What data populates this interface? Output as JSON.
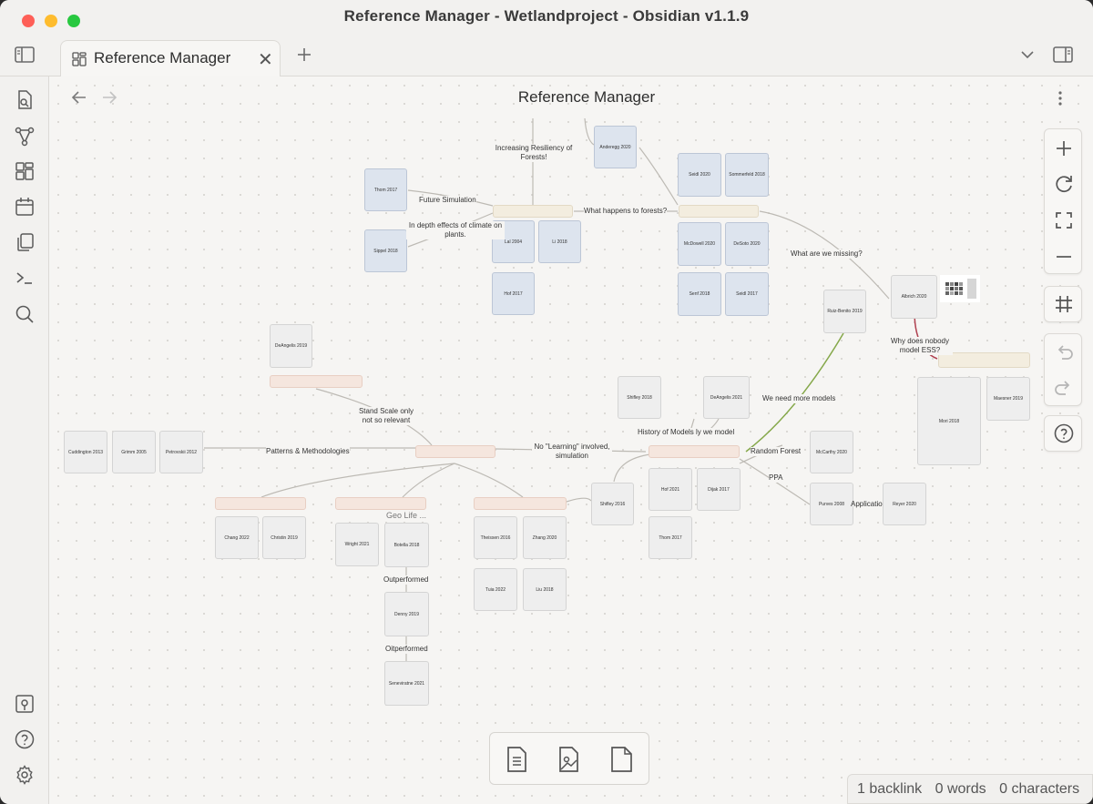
{
  "window": {
    "title": "Reference Manager - Wetlandproject - Obsidian v1.1.9"
  },
  "tab": {
    "label": "Reference Manager"
  },
  "view": {
    "title": "Reference Manager"
  },
  "status": {
    "backlinks": "1 backlink",
    "words": "0 words",
    "characters": "0 characters"
  },
  "canvas": {
    "cards": [
      "Anderegg 2020",
      "Thom 2017",
      "Seidl 2020",
      "Sommerfeld 2018",
      "Lal 2004",
      "Li 2018",
      "McDowell 2020",
      "DeSoto 2020",
      "Sippel 2018",
      "Hof 2017",
      "Senf 2018",
      "Seidl 2017",
      "Albrich 2020",
      "Ruiz-Benito 2019",
      "DeAngelis 2019",
      "Shifley 2018",
      "DeAngelis 2021",
      "Mori 2018",
      "Maesner 2019",
      "Cuddington 2013",
      "Grimm 2005",
      "Petrovskii 2012",
      "McCarthy 2020",
      "Hof 2021",
      "Dijak 2017",
      "Shifley 2016",
      "Purves 2008",
      "Reyer 2020",
      "Thom 2017",
      "Chang 2022",
      "Christin 2019",
      "Wright 2021",
      "Botella 2018",
      "Theissen 2016",
      "Zhang 2020",
      "Tuia 2022",
      "Liu 2018",
      "Denny 2019",
      "Seneviratne 2021"
    ],
    "edge_labels": [
      "Increasing Resiliency of Forests!",
      "Future Simulation",
      "In depth effects of climate on plants.",
      "What happens to forests?",
      "What are we missing?",
      "Why does nobody model ESS?",
      "We need more models",
      "Stand Scale only not so relevant",
      "Patterns & Methodologies",
      "No \"Learning\" involved, simulation",
      "History of Models ⁠ly we model",
      "Random Forest",
      "PPA",
      "Geo Life ...",
      "Outperformed",
      "Oitperformed",
      "Applicatio"
    ]
  }
}
